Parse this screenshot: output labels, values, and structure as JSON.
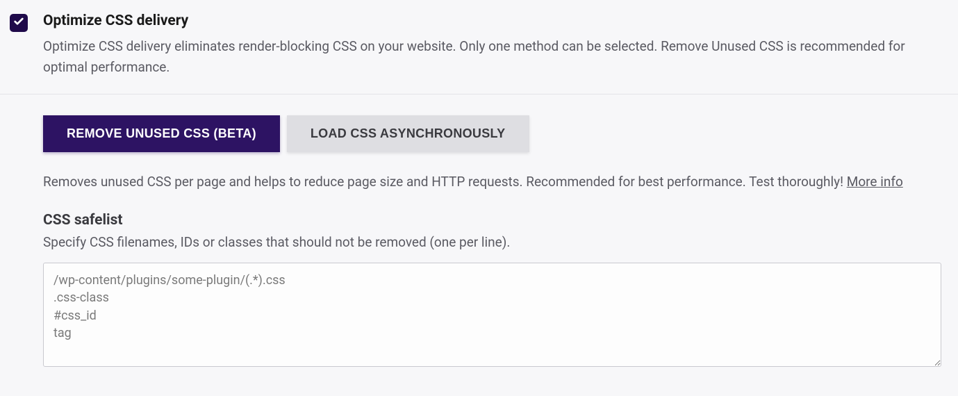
{
  "header": {
    "title": "Optimize CSS delivery",
    "description": "Optimize CSS delivery eliminates render-blocking CSS on your website. Only one method can be selected. Remove Unused CSS is recommended for optimal performance."
  },
  "buttons": {
    "remove_unused": "REMOVE UNUSED CSS (BETA)",
    "load_async": "LOAD CSS ASYNCHRONOUSLY"
  },
  "subdescription": {
    "text": "Removes unused CSS per page and helps to reduce page size and HTTP requests. Recommended for best performance. Test thoroughly! ",
    "link": "More info"
  },
  "safelist": {
    "title": "CSS safelist",
    "description": "Specify CSS filenames, IDs or classes that should not be removed (one per line).",
    "placeholder": "/wp-content/plugins/some-plugin/(.*).css\n.css-class\n#css_id\ntag"
  }
}
